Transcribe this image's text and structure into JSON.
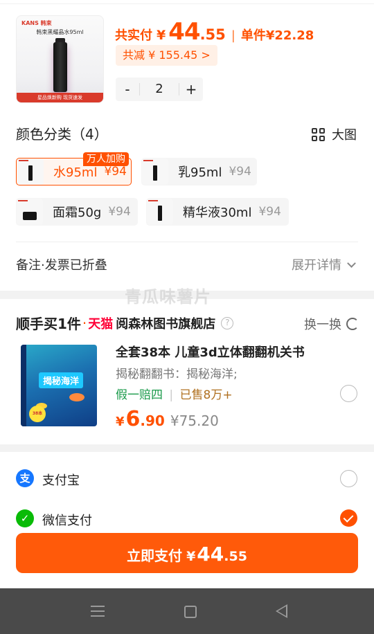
{
  "product": {
    "brand": "KANS 韩束",
    "image_name": "韩束黑耀晶水95ml",
    "image_strip": "星品焕新购 现货速发",
    "total_label": "共实付",
    "currency": "¥",
    "total_int": "44",
    "total_dec": ".55",
    "separator": "|",
    "unit_price": "单件¥22.28",
    "discount": "共减 ¥ 155.45 >",
    "qty_minus": "-",
    "qty": "2",
    "qty_plus": "+"
  },
  "variants": {
    "title": "颜色分类（4）",
    "big_view": "大图",
    "badge": "万人加购",
    "items": [
      {
        "name": "水95ml",
        "price": "¥94",
        "selected": true
      },
      {
        "name": "乳95ml",
        "price": "¥94",
        "selected": false
      },
      {
        "name": "面霜50g",
        "price": "¥94",
        "selected": false
      },
      {
        "name": "精华液30ml",
        "price": "¥94",
        "selected": false
      }
    ]
  },
  "remark": {
    "label": "备注·发票已折叠",
    "expand": "展开详情"
  },
  "watermark": "青瓜味薯片",
  "addon": {
    "title": "顺手买1件",
    "dot": "·",
    "tmall": "天猫",
    "shop": "阅森林图书旗舰店",
    "help": "?",
    "swap": "换一换",
    "book_cover_title": "揭秘海洋",
    "book_seal": "38本",
    "book_title": "全套38本 儿童3d立体翻翻机关书",
    "book_sub": "揭秘翻翻书：揭秘海洋;",
    "tag_guarantee": "假一赔四",
    "tag_sep": "|",
    "tag_sold": "已售8万+",
    "price_yen": "¥",
    "price_int": "6",
    "price_dec": ".90",
    "price_orig": "¥75.20",
    "selected": false
  },
  "payment": {
    "alipay_icon": "支",
    "alipay": "支付宝",
    "alipay_selected": false,
    "wechat_icon": "✓",
    "wechat": "微信支付",
    "wechat_selected": true
  },
  "cta": {
    "label": "立即支付",
    "yen": "¥",
    "int": "44",
    "dec": ".55"
  },
  "colors": {
    "accent": "#ff5000",
    "tmall": "#ff0036",
    "alipay": "#1677ff",
    "wechat": "#09bb07"
  }
}
